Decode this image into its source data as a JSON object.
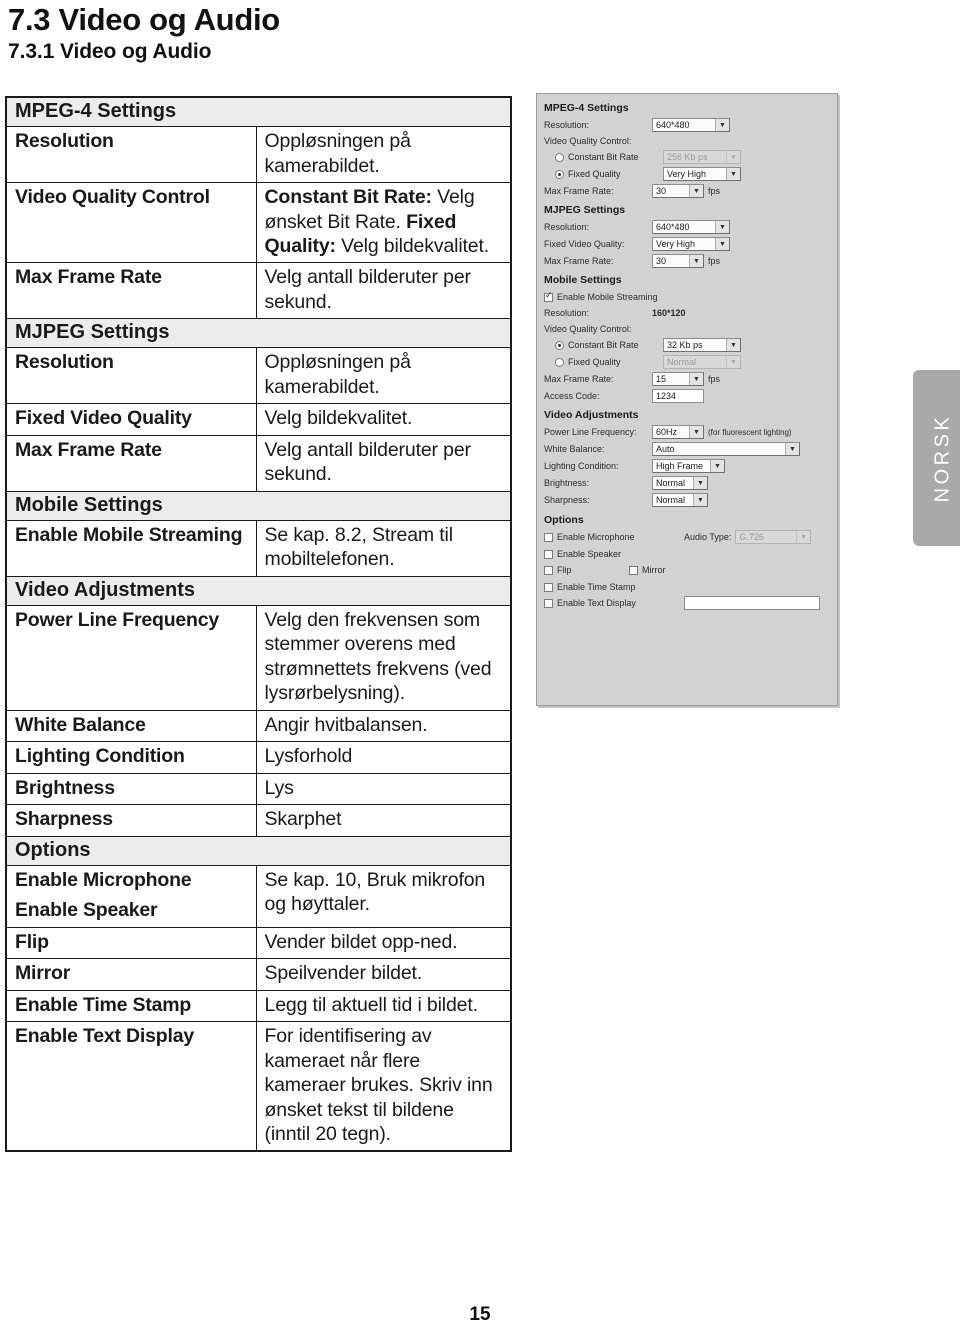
{
  "document": {
    "heading": "7.3 Video og Audio",
    "subheading": "7.3.1 Video og Audio",
    "page_number": "15",
    "side_tab": "NORSK"
  },
  "table": {
    "rows": [
      {
        "type": "section",
        "label": "MPEG-4 Settings"
      },
      {
        "type": "item",
        "key": "Resolution",
        "value": "Oppløsningen på kamerabildet."
      },
      {
        "type": "item",
        "key": "Video Quality Control",
        "value_parts": [
          {
            "bold": "Constant Bit Rate:"
          },
          {
            "text": " Velg ønsket Bit Rate. "
          },
          {
            "bold": "Fixed Quality:"
          },
          {
            "text": " Velg bildekvalitet."
          }
        ]
      },
      {
        "type": "item",
        "key": "Max Frame Rate",
        "value": "Velg antall bilderuter per sekund."
      },
      {
        "type": "section",
        "label": "MJPEG Settings"
      },
      {
        "type": "item",
        "key": "Resolution",
        "value": "Oppløsningen på kamerabildet."
      },
      {
        "type": "item",
        "key": "Fixed Video Quality",
        "value": "Velg bildekvalitet."
      },
      {
        "type": "item",
        "key": "Max Frame Rate",
        "value": "Velg antall bilderuter per sekund."
      },
      {
        "type": "section",
        "label": "Mobile Settings"
      },
      {
        "type": "item",
        "key": "Enable Mobile Streaming",
        "value": "Se kap. 8.2, Stream til mobiltelefonen."
      },
      {
        "type": "section",
        "label": "Video Adjustments"
      },
      {
        "type": "item",
        "key": "Power Line Frequency",
        "value": "Velg den frekvensen som stemmer overens med strømnettets frekvens (ved lysrørbelysning)."
      },
      {
        "type": "item",
        "key": "White Balance",
        "value": "Angir hvitbalansen."
      },
      {
        "type": "item",
        "key": "Lighting Condition",
        "value": "Lysforhold"
      },
      {
        "type": "item",
        "key": "Brightness",
        "value": "Lys"
      },
      {
        "type": "item",
        "key": "Sharpness",
        "value": "Skarphet"
      },
      {
        "type": "section",
        "label": "Options"
      },
      {
        "type": "merged",
        "keys": [
          "Enable Microphone",
          "Enable Speaker"
        ],
        "value": "Se kap. 10, Bruk mikrofon og høyttaler."
      },
      {
        "type": "item",
        "key": "Flip",
        "value": "Vender bildet opp-ned."
      },
      {
        "type": "item",
        "key": "Mirror",
        "value": "Speilvender bildet."
      },
      {
        "type": "item",
        "key": "Enable Time Stamp",
        "value": "Legg til aktuell tid i bildet."
      },
      {
        "type": "item",
        "key": "Enable Text Display",
        "value": "For identifisering av kameraet når flere kameraer brukes. Skriv inn ønsket tekst til bildene (inntil 20 tegn)."
      }
    ]
  },
  "app": {
    "mpeg4": {
      "title": "MPEG-4 Settings",
      "resolution_label": "Resolution:",
      "resolution_value": "640*480",
      "vqc_label": "Video Quality Control:",
      "cbr_label": "Constant Bit Rate",
      "cbr_value": "256 Kb ps",
      "fq_label": "Fixed Quality",
      "fq_value": "Very High",
      "mfr_label": "Max Frame Rate:",
      "mfr_value": "30",
      "fps_unit": "fps"
    },
    "mjpeg": {
      "title": "MJPEG Settings",
      "resolution_label": "Resolution:",
      "resolution_value": "640*480",
      "fvq_label": "Fixed Video Quality:",
      "fvq_value": "Very High",
      "mfr_label": "Max Frame Rate:",
      "mfr_value": "30",
      "fps_unit": "fps"
    },
    "mobile": {
      "title": "Mobile Settings",
      "enable_label": "Enable Mobile Streaming",
      "resolution_label": "Resolution:",
      "resolution_value": "160*120",
      "vqc_label": "Video Quality Control:",
      "cbr_label": "Constant Bit Rate",
      "cbr_value": "32 Kb ps",
      "fq_label": "Fixed Quality",
      "fq_value": "Normal",
      "mfr_label": "Max Frame Rate:",
      "mfr_value": "15",
      "fps_unit": "fps",
      "access_label": "Access Code:",
      "access_value": "1234"
    },
    "video_adj": {
      "title": "Video Adjustments",
      "plf_label": "Power Line Frequency:",
      "plf_value": "60Hz",
      "plf_note": "(for fluorescent lighting)",
      "wb_label": "White Balance:",
      "wb_value": "Auto",
      "lc_label": "Lighting Condition:",
      "lc_value": "High Frame",
      "br_label": "Brightness:",
      "br_value": "Normal",
      "sh_label": "Sharpness:",
      "sh_value": "Normal"
    },
    "options": {
      "title": "Options",
      "mic_label": "Enable Microphone",
      "audio_type_label": "Audio Type:",
      "audio_type_value": "G.726",
      "speaker_label": "Enable Speaker",
      "flip_label": "Flip",
      "mirror_label": "Mirror",
      "timestamp_label": "Enable Time Stamp",
      "textdisplay_label": "Enable Text Display",
      "text_value": ""
    }
  }
}
